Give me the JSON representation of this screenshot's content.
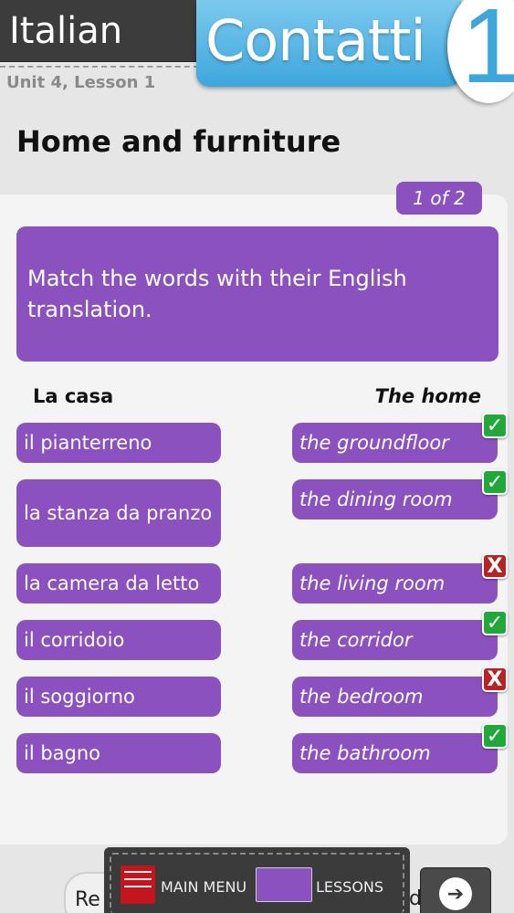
{
  "header": {
    "language": "Italian",
    "unit": "Unit 4, Lesson 1",
    "brand": "Contatti",
    "brand_number": "1"
  },
  "page": {
    "title": "Home and furniture",
    "counter": "1 of 2",
    "instructions": "Match the words with their English translation."
  },
  "columns": {
    "left": "La casa",
    "right": "The home"
  },
  "pairs": [
    {
      "italian": "il pianterreno",
      "english": "the groundfloor",
      "result": "correct"
    },
    {
      "italian": "la stanza da pranzo",
      "english": "the dining room",
      "result": "correct"
    },
    {
      "italian": "la camera da letto",
      "english": "the living room",
      "result": "incorrect"
    },
    {
      "italian": "il corridoio",
      "english": "the corridor",
      "result": "correct"
    },
    {
      "italian": "il soggiorno",
      "english": "the bedroom",
      "result": "incorrect"
    },
    {
      "italian": "il bagno",
      "english": "the bathroom",
      "result": "correct"
    }
  ],
  "marks": {
    "correct_symbol": "✓",
    "incorrect_symbol": "X"
  },
  "footer": {
    "left_button_text": "Re",
    "main_menu_label": "MAIN MENU",
    "lessons_label": "LESSONS",
    "right_partial_text": "d",
    "next_icon": "arrow-right-icon"
  },
  "colors": {
    "accent_purple": "#8b51be",
    "brand_blue": "#3da7dc",
    "correct_green": "#21a83a",
    "incorrect_red": "#b52424"
  }
}
